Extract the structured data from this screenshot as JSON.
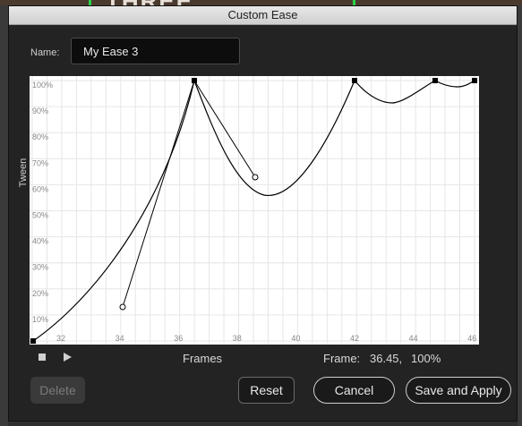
{
  "background": {
    "partial_text": "THREE"
  },
  "dialog": {
    "title": "Custom Ease",
    "name_label": "Name:",
    "name_value": "My Ease 3"
  },
  "graph": {
    "y_axis_title": "Tween",
    "x_axis_title": "Frames",
    "y_ticks": [
      "100%",
      "90%",
      "80%",
      "70%",
      "60%",
      "50%",
      "40%",
      "30%",
      "20%",
      "10%"
    ],
    "x_ticks": [
      "32",
      "34",
      "36",
      "38",
      "40",
      "42",
      "44",
      "46"
    ]
  },
  "status": {
    "frame_label": "Frame:",
    "frame_value": "36.45,",
    "tween_value": "100%"
  },
  "buttons": {
    "delete": "Delete",
    "reset": "Reset",
    "cancel": "Cancel",
    "save_apply": "Save and Apply"
  },
  "colors": {
    "dialog_bg": "#232323",
    "graph_bg": "#ffffff",
    "grid": "#e6e6e6",
    "curve": "#000000"
  }
}
